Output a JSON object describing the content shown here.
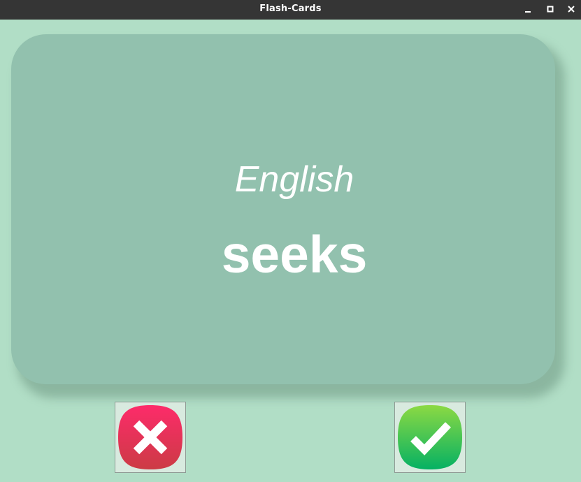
{
  "window": {
    "title": "Flash-Cards",
    "controls": [
      "minimize",
      "maximize",
      "close"
    ]
  },
  "card": {
    "language": "English",
    "word": "seeks",
    "background_color": "#92c1ae",
    "text_color": "#ffffff"
  },
  "answer_buttons": {
    "wrong": {
      "icon": "x-icon",
      "color_top": "#fd2b6a",
      "color_bottom": "#cc3b45"
    },
    "right": {
      "icon": "checkmark-icon",
      "color_top": "#8cd943",
      "color_bottom": "#05b163"
    }
  },
  "theme": {
    "window_background": "#b1dec6",
    "titlebar_background": "#353535"
  }
}
